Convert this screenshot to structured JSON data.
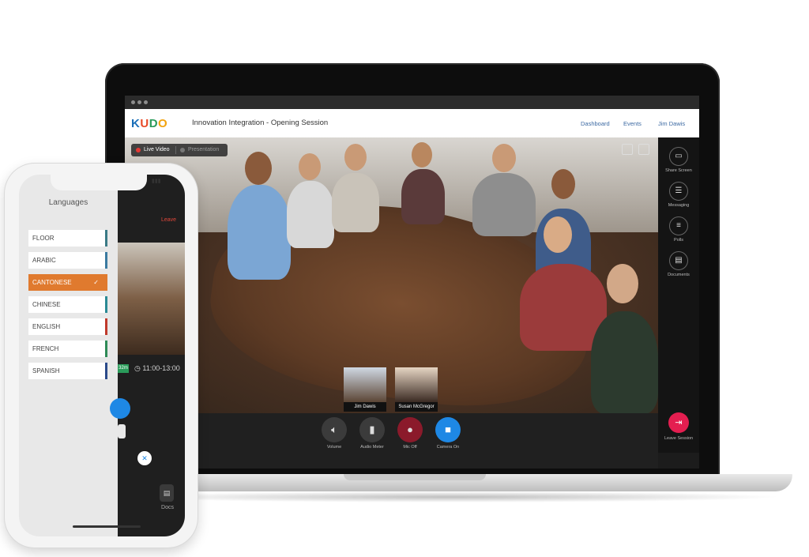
{
  "app": {
    "logo": "KUDO",
    "session_title": "Innovation Integration - Opening Session",
    "nav": [
      "Dashboard",
      "Events",
      "Jim Dawis"
    ]
  },
  "video_tabs": {
    "live": "Live Video",
    "presentation": "Presentation"
  },
  "participants": [
    {
      "name": "Jim Dawis"
    },
    {
      "name": "Susan McGregor"
    }
  ],
  "side_panel": [
    {
      "label": "Share Screen",
      "icon": "share-screen-icon"
    },
    {
      "label": "Messaging",
      "icon": "messaging-icon"
    },
    {
      "label": "Polls",
      "icon": "polls-icon"
    },
    {
      "label": "Documents",
      "icon": "documents-icon"
    }
  ],
  "controls": [
    {
      "label": "Volume",
      "icon": "volume-icon"
    },
    {
      "label": "Audio Meter",
      "icon": "audio-meter-icon"
    },
    {
      "label": "Mic Off",
      "icon": "mic-off-icon"
    },
    {
      "label": "Camera On",
      "icon": "camera-icon"
    }
  ],
  "leave_session": "Leave Session",
  "colors": {
    "accent_orange": "#e07a2e",
    "mic_red": "#8b1a2b",
    "camera_blue": "#1e88e5",
    "leave_pink": "#e41e50"
  },
  "phone": {
    "languages_title": "Languages",
    "languages": [
      {
        "name": "FLOOR",
        "color": "#3a7a86"
      },
      {
        "name": "ARABIC",
        "color": "#3a7aa0"
      },
      {
        "name": "CANTONESE",
        "color": "#e07a2e",
        "selected": true
      },
      {
        "name": "CHINESE",
        "color": "#2a8a94"
      },
      {
        "name": "ENGLISH",
        "color": "#c0392b"
      },
      {
        "name": "FRENCH",
        "color": "#2e8b57"
      },
      {
        "name": "SPANISH",
        "color": "#2a4a8a"
      }
    ],
    "check_mark": "✓",
    "leave": "Leave",
    "time_badge": "32m",
    "time_range": "11:00-13:00",
    "close_symbol": "✕",
    "docs": "Docs"
  }
}
